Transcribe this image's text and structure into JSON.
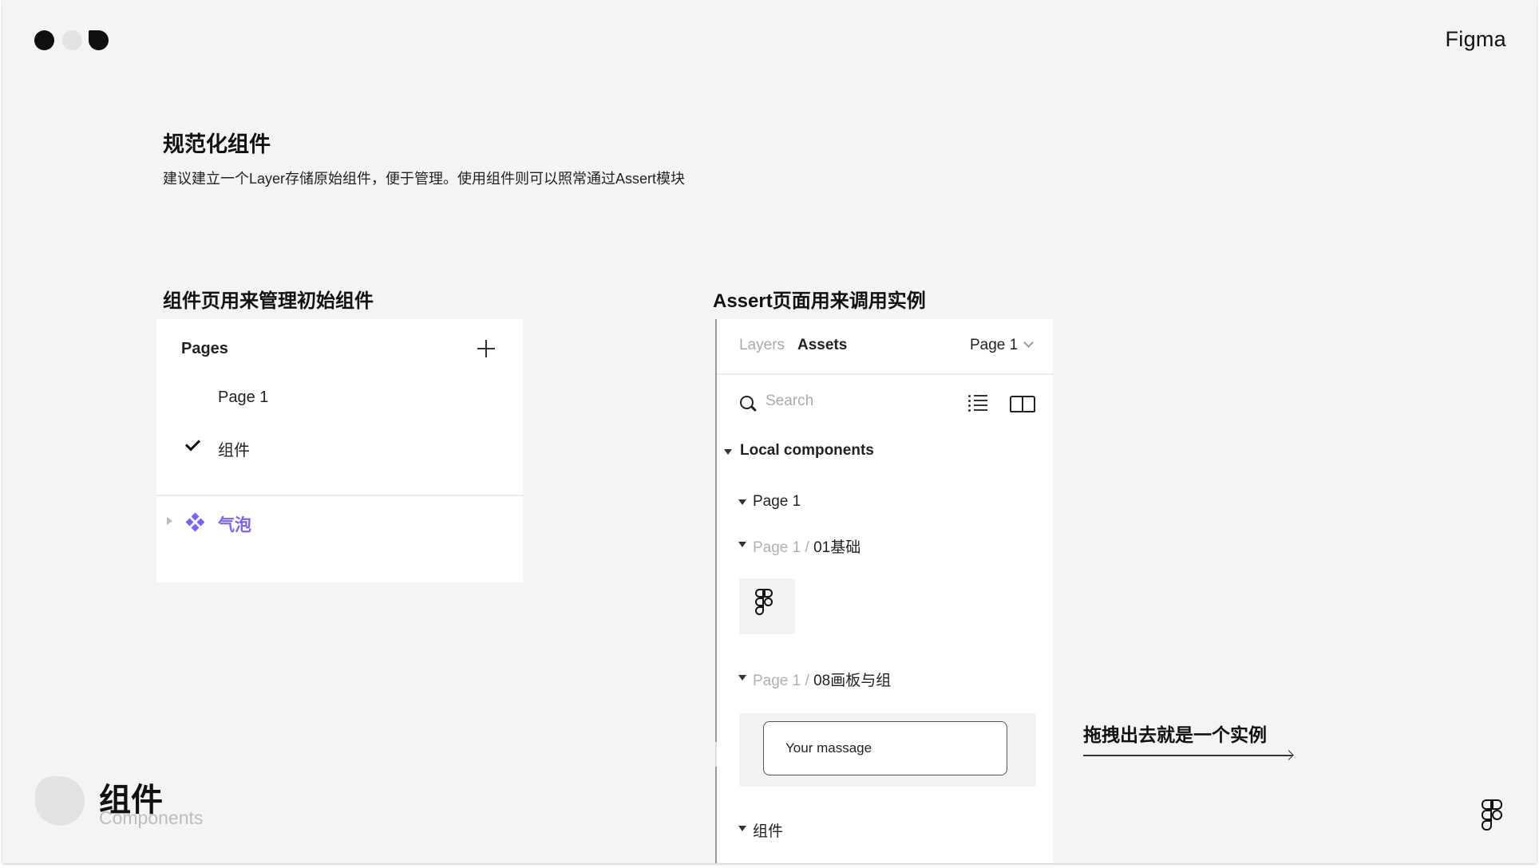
{
  "brand": "Figma",
  "header": {
    "title": "规范化组件",
    "description": "建议建立一个Layer存储原始组件，便于管理。使用组件则可以照常通过Assert模块"
  },
  "left_section": {
    "heading": "组件页用来管理初始组件",
    "pages_panel": {
      "title": "Pages",
      "add_icon": "plus-icon",
      "pages": [
        "Page 1",
        "组件"
      ],
      "selected_page": "组件",
      "component_layer": "气泡"
    }
  },
  "right_section": {
    "heading": "Assert页面用来调用实例",
    "assets_panel": {
      "tabs": [
        "Layers",
        "Assets"
      ],
      "active_tab": "Assets",
      "page_selector": "Page 1",
      "search_placeholder": "Search",
      "local_components_label": "Local components",
      "groups": [
        {
          "label": "Page 1"
        },
        {
          "prefix": "Page 1 / ",
          "label": "01基础"
        },
        {
          "prefix": "Page 1 / ",
          "label": "08画板与组"
        },
        {
          "label": "组件"
        }
      ],
      "instance_text": "Your massage"
    }
  },
  "drag_note": "拖拽出去就是一个实例",
  "footer": {
    "title_cn": "组件",
    "title_en": "Components"
  },
  "colors": {
    "background": "#f4f4f4",
    "accent_purple": "#7b61ff",
    "text": "#111111"
  }
}
